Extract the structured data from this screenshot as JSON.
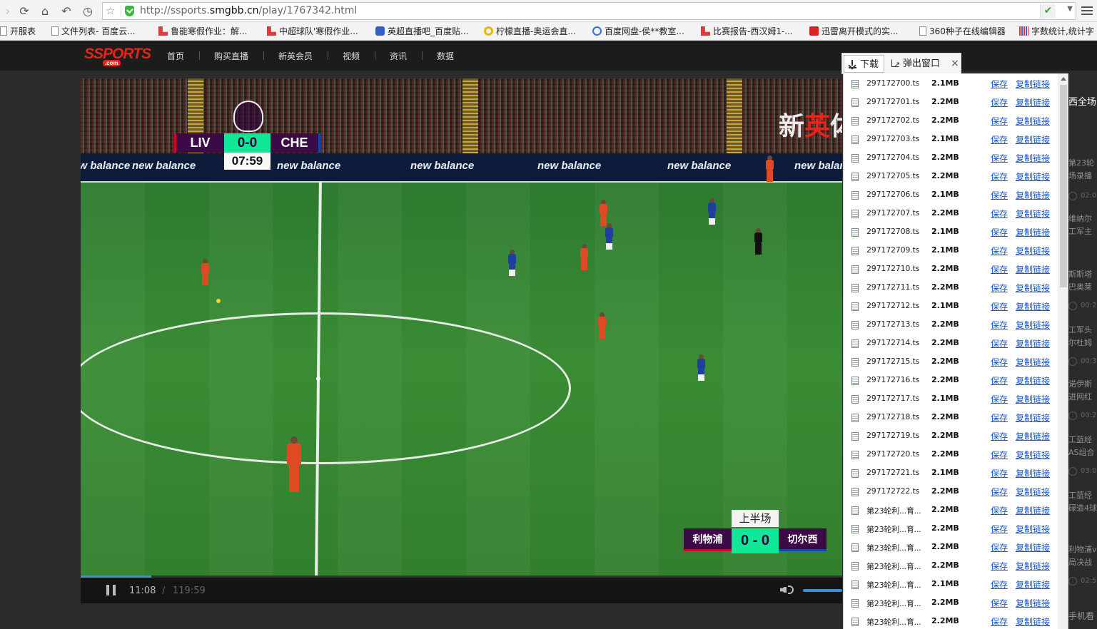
{
  "browser": {
    "url_prefix": "http://ssports.",
    "url_domain": "smgbb.cn",
    "url_path": "/play/1767342.html",
    "bookmarks": [
      {
        "label": "开服表",
        "icon": "page-icon"
      },
      {
        "label": "文件列表- 百度云...",
        "icon": "page-icon"
      },
      {
        "label": "鲁能寒假作业：解...",
        "icon": "ls-red-icon"
      },
      {
        "label": "中超球队'寒假作业...",
        "icon": "ls-red-icon"
      },
      {
        "label": "英超直播吧_百度贴...",
        "icon": "baidu-paw-icon"
      },
      {
        "label": "柠檬直播-奥运会直...",
        "icon": "lemon-icon"
      },
      {
        "label": "百度网盘-侯**教室...",
        "icon": "baidu-netdisk-icon"
      },
      {
        "label": "比赛报告-西汉姆1-...",
        "icon": "ls-red-icon"
      },
      {
        "label": "迅雷离开模式的实...",
        "icon": "xunlei-icon"
      },
      {
        "label": "360种子在线编辑器",
        "icon": "page-icon"
      },
      {
        "label": "字数统计,统计字",
        "icon": "bars-icon"
      }
    ]
  },
  "site": {
    "logo_text": "SSPORTS",
    "logo_sub": ".com",
    "nav": [
      "首页",
      "购买直播",
      "新英会员",
      "视频",
      "资讯",
      "数据"
    ]
  },
  "video": {
    "scoreboard": {
      "home": "LIV",
      "away": "CHE",
      "score": "0-0",
      "clock": "07:59"
    },
    "watermark_a": "新",
    "watermark_b": "英",
    "watermark_c": "体",
    "board_text": "new balance",
    "overlay": {
      "half": "上半场",
      "home": "利物浦",
      "score": "0 - 0",
      "away": "切尔西"
    }
  },
  "player": {
    "current_time": "11:08",
    "separator": "/",
    "total_time": "119:59",
    "progress": 0.093
  },
  "sidebar": {
    "title": "西全场",
    "items": [
      "第23轮",
      "场录播",
      "02:0",
      "维纳尔",
      "工军主",
      "斯斯塔",
      "巴奥莱",
      "00:2",
      "工军头",
      "尔杜姆",
      "00:3",
      "诺伊斯",
      "进网红",
      "00:2",
      "工蓝经",
      "AS组合",
      "03:0",
      "工蓝经",
      "碌造4球",
      "利物浦v",
      "局决战",
      "02:5",
      "手机看"
    ]
  },
  "download_popup": {
    "tab_download": "下载",
    "tab_popout": "弹出窗口",
    "close": "×",
    "save_label": "保存",
    "copy_label": "复制链接",
    "files": [
      {
        "name": "297172700.ts",
        "size": "2.1MB"
      },
      {
        "name": "297172701.ts",
        "size": "2.2MB"
      },
      {
        "name": "297172702.ts",
        "size": "2.2MB"
      },
      {
        "name": "297172703.ts",
        "size": "2.1MB"
      },
      {
        "name": "297172704.ts",
        "size": "2.2MB"
      },
      {
        "name": "297172705.ts",
        "size": "2.2MB"
      },
      {
        "name": "297172706.ts",
        "size": "2.1MB"
      },
      {
        "name": "297172707.ts",
        "size": "2.2MB"
      },
      {
        "name": "297172708.ts",
        "size": "2.1MB"
      },
      {
        "name": "297172709.ts",
        "size": "2.1MB"
      },
      {
        "name": "297172710.ts",
        "size": "2.2MB"
      },
      {
        "name": "297172711.ts",
        "size": "2.2MB"
      },
      {
        "name": "297172712.ts",
        "size": "2.1MB"
      },
      {
        "name": "297172713.ts",
        "size": "2.2MB"
      },
      {
        "name": "297172714.ts",
        "size": "2.2MB"
      },
      {
        "name": "297172715.ts",
        "size": "2.2MB"
      },
      {
        "name": "297172716.ts",
        "size": "2.2MB"
      },
      {
        "name": "297172717.ts",
        "size": "2.1MB"
      },
      {
        "name": "297172718.ts",
        "size": "2.2MB"
      },
      {
        "name": "297172719.ts",
        "size": "2.2MB"
      },
      {
        "name": "297172720.ts",
        "size": "2.2MB"
      },
      {
        "name": "297172721.ts",
        "size": "2.1MB"
      },
      {
        "name": "297172722.ts",
        "size": "2.2MB"
      },
      {
        "name": "第23轮利...育...",
        "size": "2.2MB"
      },
      {
        "name": "第23轮利...育...",
        "size": "2.2MB"
      },
      {
        "name": "第23轮利...育...",
        "size": "2.2MB"
      },
      {
        "name": "第23轮利...育...",
        "size": "2.2MB"
      },
      {
        "name": "第23轮利...育...",
        "size": "2.1MB"
      },
      {
        "name": "第23轮利...育...",
        "size": "2.2MB"
      },
      {
        "name": "第23轮利...育...",
        "size": "2.2MB"
      }
    ]
  }
}
